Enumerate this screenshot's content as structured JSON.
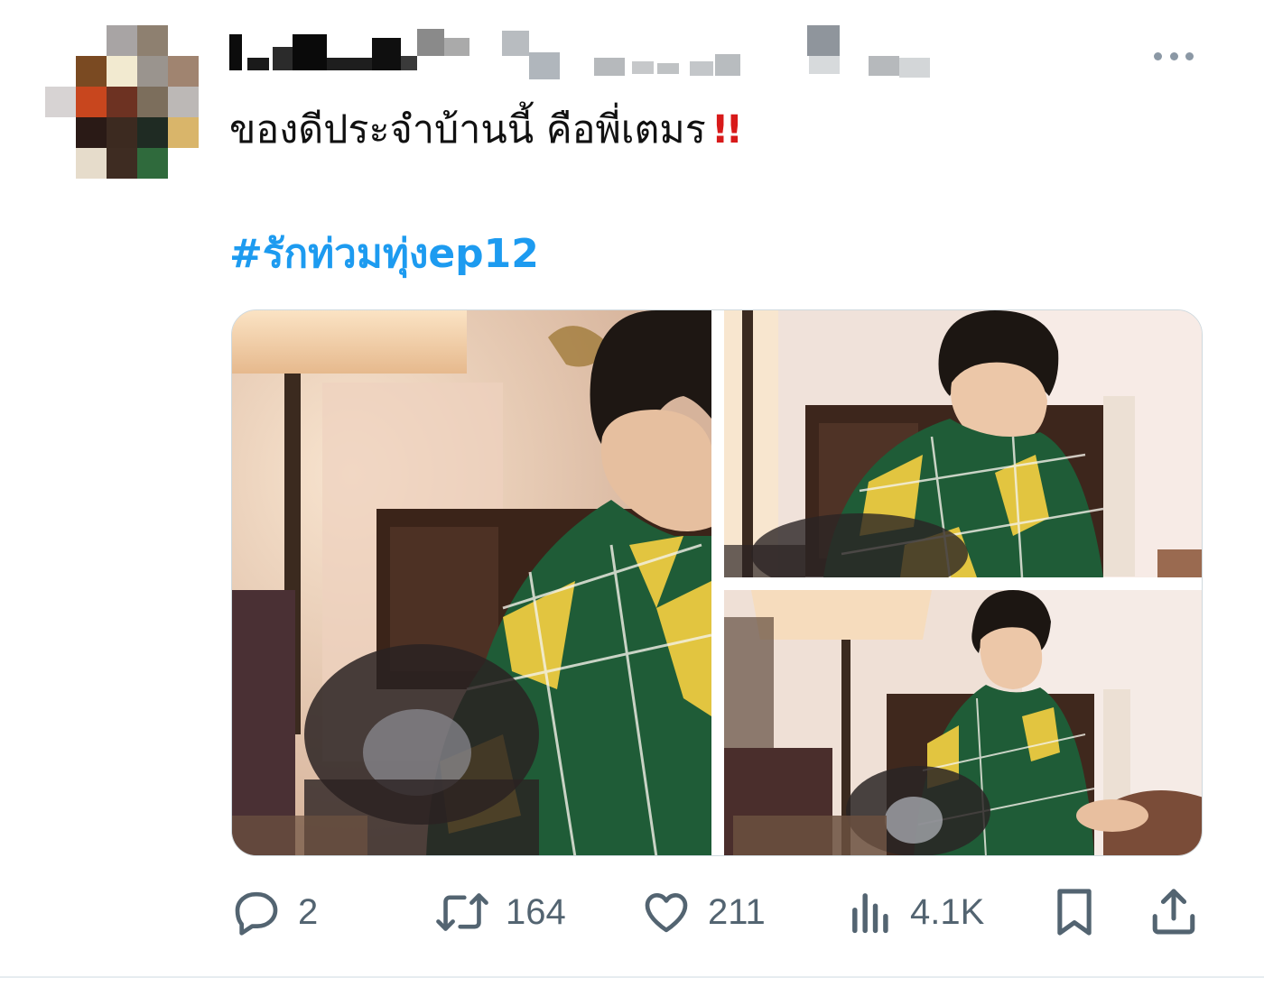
{
  "tweet": {
    "text": "ของดีประจำบ้านนี้ คือพี่เตมร",
    "text_emoji": "!!",
    "hashtag": "#รักท่วมทุ่งep12"
  },
  "media": {
    "photo_count": 3
  },
  "actions": {
    "reply_count": "2",
    "retweet_count": "164",
    "like_count": "211",
    "view_count": "4.1K"
  },
  "icons": {
    "more": "more-icon",
    "reply": "reply-icon",
    "retweet": "retweet-icon",
    "like": "heart-icon",
    "views": "views-icon",
    "bookmark": "bookmark-icon",
    "share": "share-icon"
  },
  "colors": {
    "hashtag": "#1d9bf0",
    "action_gray": "#536471",
    "emoji_red": "#d81a1a",
    "shirt_green": "#1d5a35",
    "shirt_yellow": "#e2c540"
  }
}
